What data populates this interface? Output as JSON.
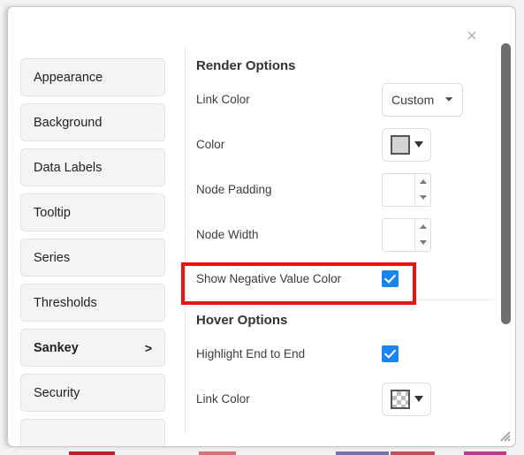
{
  "dialog": {
    "close_label": "×"
  },
  "sidebar": {
    "items": [
      {
        "label": "Appearance",
        "active": false,
        "chevron": ""
      },
      {
        "label": "Background",
        "active": false,
        "chevron": ""
      },
      {
        "label": "Data Labels",
        "active": false,
        "chevron": ""
      },
      {
        "label": "Tooltip",
        "active": false,
        "chevron": ""
      },
      {
        "label": "Series",
        "active": false,
        "chevron": ""
      },
      {
        "label": "Thresholds",
        "active": false,
        "chevron": ""
      },
      {
        "label": "Sankey",
        "active": true,
        "chevron": ">"
      },
      {
        "label": "Security",
        "active": false,
        "chevron": ""
      },
      {
        "label": "",
        "active": false,
        "chevron": ""
      }
    ]
  },
  "render_options": {
    "title": "Render Options",
    "link_color": {
      "label": "Link Color",
      "value": "Custom",
      "chevron": "⌄"
    },
    "color": {
      "label": "Color",
      "swatch_color": "#d4d4d4"
    },
    "node_padding": {
      "label": "Node Padding",
      "value": ""
    },
    "node_width": {
      "label": "Node Width",
      "value": ""
    },
    "show_negative_value_color": {
      "label": "Show Negative Value Color",
      "checked": true
    }
  },
  "hover_options": {
    "title": "Hover Options",
    "highlight_end_to_end": {
      "label": "Highlight End to End",
      "checked": true
    },
    "link_color": {
      "label": "Link Color",
      "swatch_type": "transparent-checkerboard"
    }
  },
  "colors": {
    "highlight_box": "#ee1111",
    "checkbox_blue": "#1a85f0",
    "scrollbar_thumb": "#6e6e6e"
  }
}
